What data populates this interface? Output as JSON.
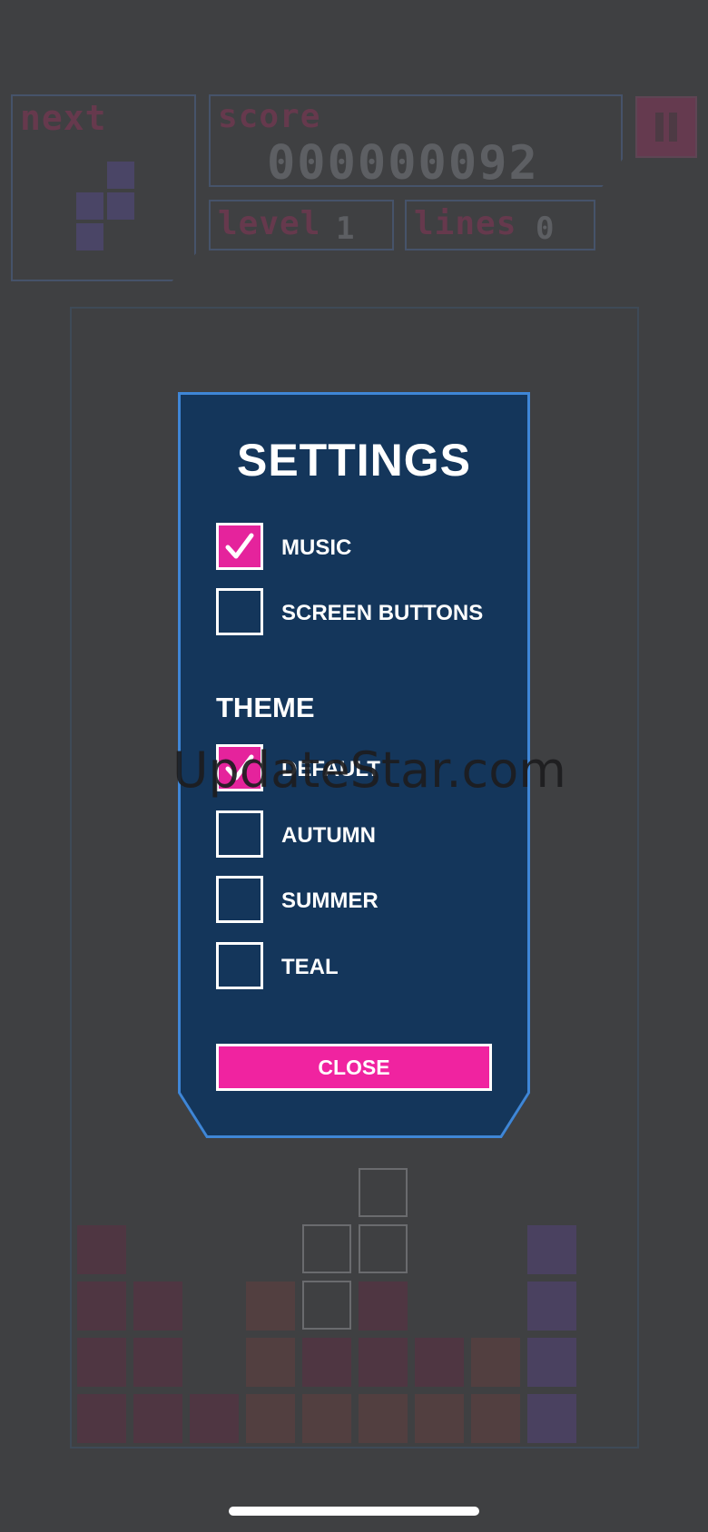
{
  "hud": {
    "next_label": "next",
    "score_label": "score",
    "score_value": "000000092",
    "level_label": "level",
    "level_value": "1",
    "lines_label": "lines",
    "lines_value": "0",
    "pause_icon": "pause-icon"
  },
  "settings": {
    "title": "SETTINGS",
    "options": [
      {
        "label": "MUSIC",
        "checked": true
      },
      {
        "label": "SCREEN BUTTONS",
        "checked": false
      }
    ],
    "theme_title": "THEME",
    "themes": [
      {
        "label": "DEFAULT",
        "checked": true
      },
      {
        "label": "AUTUMN",
        "checked": false
      },
      {
        "label": "SUMMER",
        "checked": false
      },
      {
        "label": "TEAL",
        "checked": false
      }
    ],
    "close_label": "CLOSE"
  },
  "watermark": "UpdateStar.com",
  "colors": {
    "modal_bg": "#14365b",
    "modal_border": "#3f86d6",
    "accent": "#e5239c",
    "page_bg": "#3f4042"
  }
}
